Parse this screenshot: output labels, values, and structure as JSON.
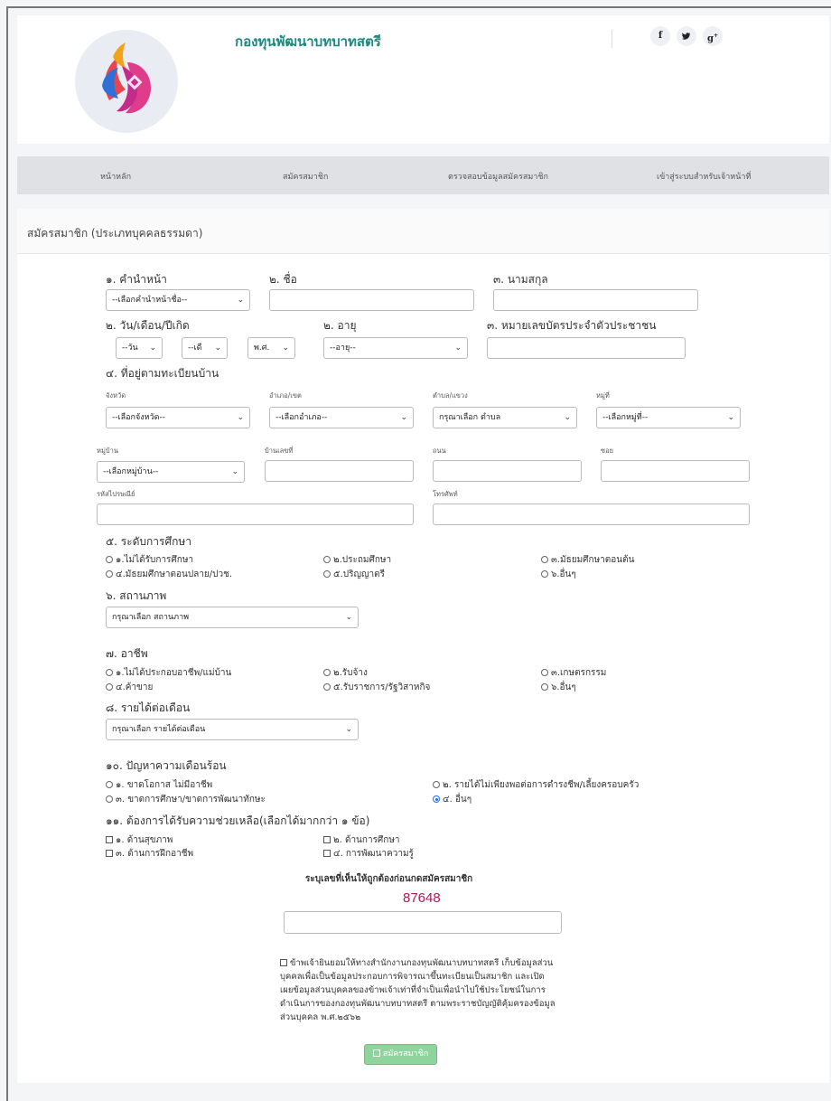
{
  "header": {
    "site_title": "กองทุนพัฒนาบทบาทสตรี",
    "social": [
      {
        "icon": "facebook-icon",
        "glyph": "f"
      },
      {
        "icon": "twitter-icon",
        "glyph": "🐦"
      },
      {
        "icon": "google-plus-icon",
        "glyph": "g+"
      }
    ]
  },
  "nav": {
    "items": [
      "หน้าหลัก",
      "สมัครสมาชิก",
      "ตรวจสอบข้อมูลสมัครสมาชิก",
      "เข้าสู่ระบบสำหรับเจ้าหน้าที่"
    ]
  },
  "panel_title": "สมัครสมาชิก (ประเภทบุคคลธรรมดา)",
  "form": {
    "f1_label": "๑. คำนำหน้า",
    "f1_select": "--เลือกคำนำหน้าชื่อ--",
    "f2_label": "๒. ชื่อ",
    "f3_label": "๓. นามสกุล",
    "dob_label": "๒. วัน/เดือน/ปีเกิด",
    "dob_day": "--วัน",
    "dob_month": "--เดื",
    "dob_year": "พ.ศ.",
    "age_label": "๒. อายุ",
    "age_select": "--อายุ--",
    "id_label": "๓. หมายเลขบัตรประจำตัวประชาชน",
    "addr_label": "๔. ที่อยู่ตามทะเบียนบ้าน",
    "province_label": "จังหวัด",
    "province_select": "--เลือกจังหวัด--",
    "district_label": "อำเภอ/เขต",
    "district_select": "--เลือกอำเภอ--",
    "subdistrict_label": "ตำบล/แขวง",
    "subdistrict_select": "กรุณาเลือก ตำบล",
    "moo_label": "หมู่ที่",
    "moo_select": "--เลือกหมู่ที่--",
    "village_label": "หมู่บ้าน",
    "village_select": "--เลือกหมู่บ้าน--",
    "house_no_label": "บ้านเลขที่",
    "road_label": "ถนน",
    "soi_label": "ซอย",
    "postcode_label": "รหัสไปรษณีย์",
    "phone_label": "โทรศัพท์",
    "edu_label": "๕. ระดับการศึกษา",
    "edu_options": [
      "๑.ไม่ได้รับการศึกษา",
      "๒.ประถมศึกษา",
      "๓.มัธยมศึกษาตอนต้น",
      "๔.มัธยมศึกษาตอนปลาย/ปวช.",
      "๕.ปริญญาตรี",
      "๖.อื่นๆ"
    ],
    "status_label": "๖. สถานภาพ",
    "status_select": "กรุณาเลือก สถานภาพ",
    "job_label": "๗. อาชีพ",
    "job_options": [
      "๑.ไม่ได้ประกอบอาชีพ/แม่บ้าน",
      "๒.รับจ้าง",
      "๓.เกษตรกรรม",
      "๔.ค้าขาย",
      "๕.รับราชการ/รัฐวิสาหกิจ",
      "๖.อื่นๆ"
    ],
    "income_label": "๘. รายได้ต่อเดือน",
    "income_select": "กรุณาเลือก รายได้ต่อเดือน",
    "problem_label": "๑๐. ปัญหาความเดือนร้อน",
    "problem_options": [
      "๑. ขาดโอกาส ไม่มีอาชีพ",
      "๒. รายได้ไม่เพียงพอต่อการดำรงชีพ/เลี้ยงครอบครัว",
      "๓. ขาดการศึกษา/ขาดการพัฒนาทักษะ",
      "๔. อื่นๆ"
    ],
    "problem_selected": "๔. อื่นๆ",
    "help_label": "๑๑. ต้องการได้รับความช่วยเหลือ(เลือกได้มากกว่า ๑ ข้อ)",
    "help_options": [
      "๑. ด้านสุขภาพ",
      "๒. ด้านการศึกษา",
      "๓. ด้านการฝึกอาชีพ",
      "๔. การพัฒนาความรู้"
    ]
  },
  "captcha": {
    "label": "ระบุเลขที่เห็นให้ถูกต้องก่อนกดสมัครสมาชิก",
    "code": "87648"
  },
  "consent_text": "ข้าพเจ้ายินยอมให้ทางสำนักงานกองทุนพัฒนาบทบาทสตรี เก็บข้อมูลส่วนบุคคลเพื่อเป็นข้อมูลประกอบการพิจารณาขึ้นทะเบียนเป็นสมาชิก และเปิดเผยข้อมูลส่วนบุคคลของข้าพเจ้าเท่าที่จำเป็นเพื่อนำไปใช้ประโยชน์ในการดำเนินการของกองทุนพัฒนาบทบาทสตรี ตามพระราชบัญญัติคุ้มครองข้อมูลส่วนบุคคล พ.ศ.๒๕๖๒",
  "submit_label": "สมัครสมาชิก",
  "colors": {
    "brand": "#1a8a80",
    "captcha": "#b0175a",
    "submit": "#8fd49d"
  }
}
